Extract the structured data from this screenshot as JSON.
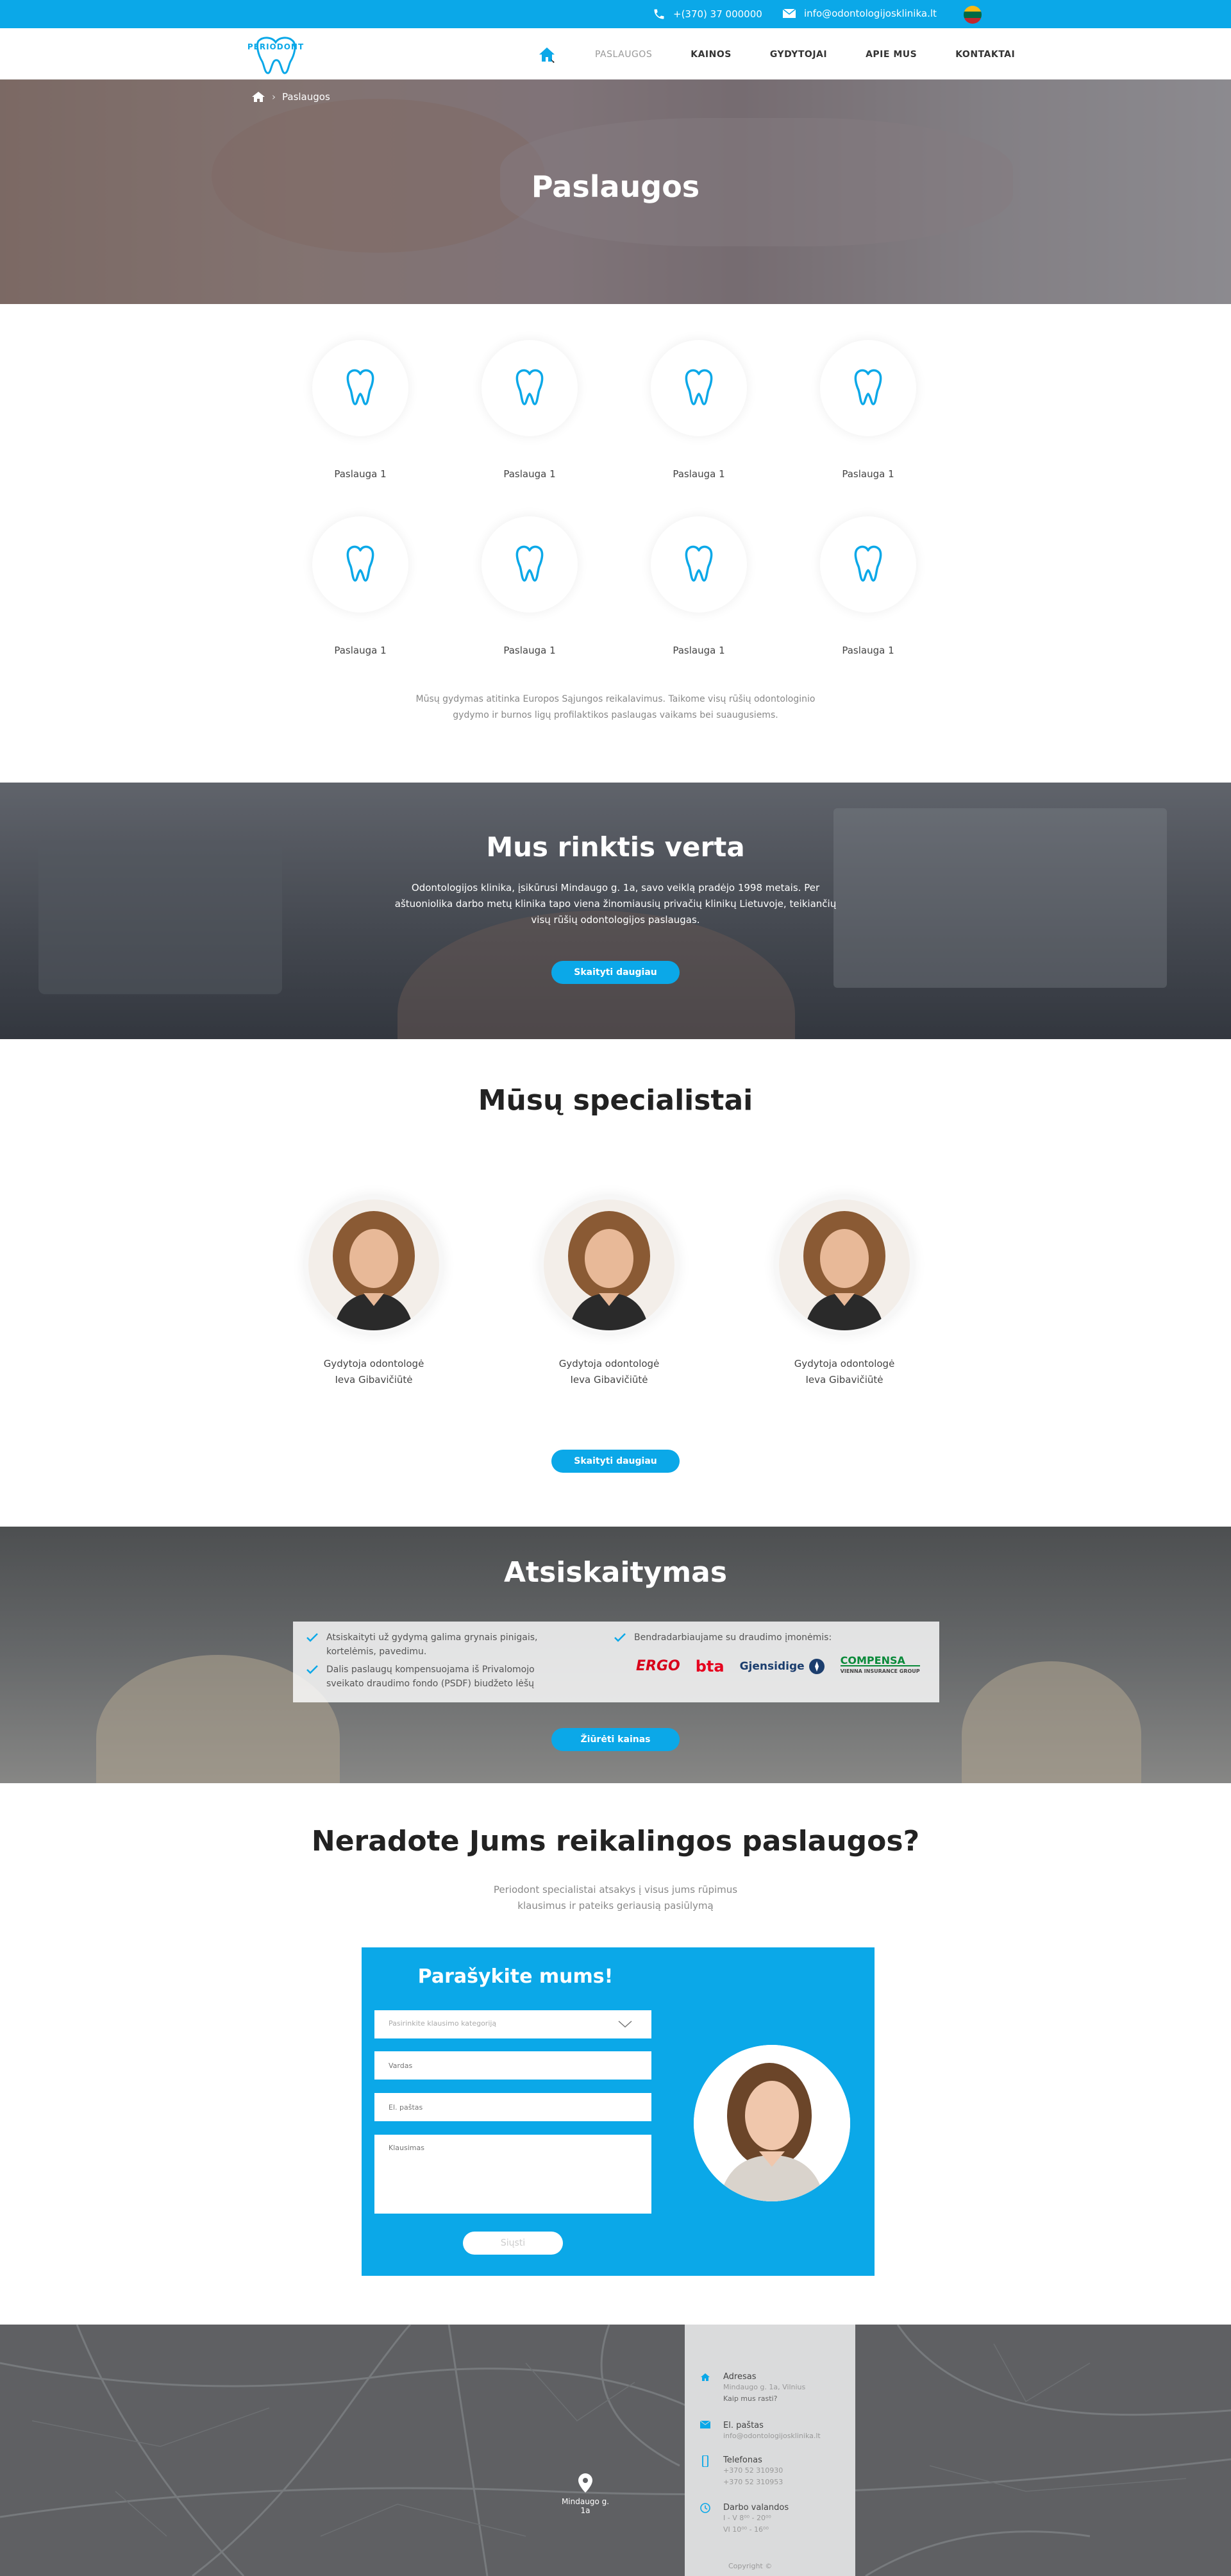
{
  "topbar": {
    "phone": "+(370) 37 000000",
    "email": "info@odontologijosklinika.lt",
    "language": "LT"
  },
  "brand": {
    "logo_text": "PERIODONT",
    "accent": "#0ba8e8"
  },
  "nav": {
    "items": [
      "PASLAUGOS",
      "KAINOS",
      "GYDYTOJAI",
      "APIE MUS",
      "KONTAKTAI"
    ],
    "active": "PASLAUGOS"
  },
  "hero": {
    "breadcrumb": "Paslaugos",
    "title": "Paslaugos"
  },
  "services": {
    "items": [
      "Paslauga 1",
      "Paslauga 1",
      "Paslauga 1",
      "Paslauga 1",
      "Paslauga 1",
      "Paslauga 1",
      "Paslauga 1",
      "Paslauga 1"
    ],
    "description": "Mūsų gydymas atitinka Europos Sąjungos reikalavimus. Taikome visų rūšių odontologinio gydymo ir burnos ligų profilaktikos paslaugas vaikams bei suaugusiems."
  },
  "why": {
    "title": "Mus rinktis verta",
    "text": "Odontologijos klinika, įsikūrusi Mindaugo g. 1a, savo veiklą pradėjo 1998 metais. Per aštuoniolika darbo metų klinika tapo viena žinomiausių privačių klinikų Lietuvoje, teikiančių visų rūšių odontologijos paslaugas.",
    "button": "Skaityti daugiau"
  },
  "specialists": {
    "title": "Mūsų specialistai",
    "people": [
      {
        "role": "Gydytoja odontologė",
        "name": "Ieva Gibavičiūtė"
      },
      {
        "role": "Gydytoja odontologė",
        "name": "Ieva Gibavičiūtė"
      },
      {
        "role": "Gydytoja odontologė",
        "name": "Ieva Gibavičiūtė"
      }
    ],
    "button": "Skaityti daugiau"
  },
  "payment": {
    "title": "Atsiskaitymas",
    "left": [
      "Atsiskaityti už gydymą galima grynais pinigais, kortelėmis, pavedimu.",
      "Dalis paslaugų kompensuojama iš Privalomojo sveikato draudimo fondo (PSDF) biudžeto lėšų"
    ],
    "right": "Bendradarbiaujame su draudimo įmonėmis:",
    "insurers": [
      "ERGO",
      "bta",
      "Gjensidige",
      "COMPENSA"
    ],
    "compensa_sub": "VIENNA INSURANCE GROUP",
    "button": "Žiūrėti kainas"
  },
  "contact": {
    "title": "Neradote Jums reikalingos paslaugos?",
    "subtitle": "Periodont specialistai atsakys į visus jums rūpimus klausimus ir pateiks geriausią pasiūlymą",
    "form_title": "Parašykite mums!",
    "category_placeholder": "Pasirinkite klausimo kategoriją",
    "name_placeholder": "Vardas",
    "email_placeholder": "El. paštas",
    "message_placeholder": "Klausimas",
    "send": "Siųsti"
  },
  "map": {
    "pin_label": "Mindaugo g. 1a",
    "address_title": "Adresas",
    "address_value": "Mindaugo g. 1a, Vilnius",
    "address_link": "Kaip mus rasti?",
    "email_title": "El. paštas",
    "email_value": "info@odontologijosklinika.lt",
    "phone_title": "Telefonas",
    "phone_1": "+370 52 310930",
    "phone_2": "+370 52 310953",
    "hours_title": "Darbo valandos",
    "hours_1": "I - V  8⁰⁰ - 20⁰⁰",
    "hours_2": "VI  10⁰⁰ - 16⁰⁰",
    "copyright": "Copyright ©"
  }
}
